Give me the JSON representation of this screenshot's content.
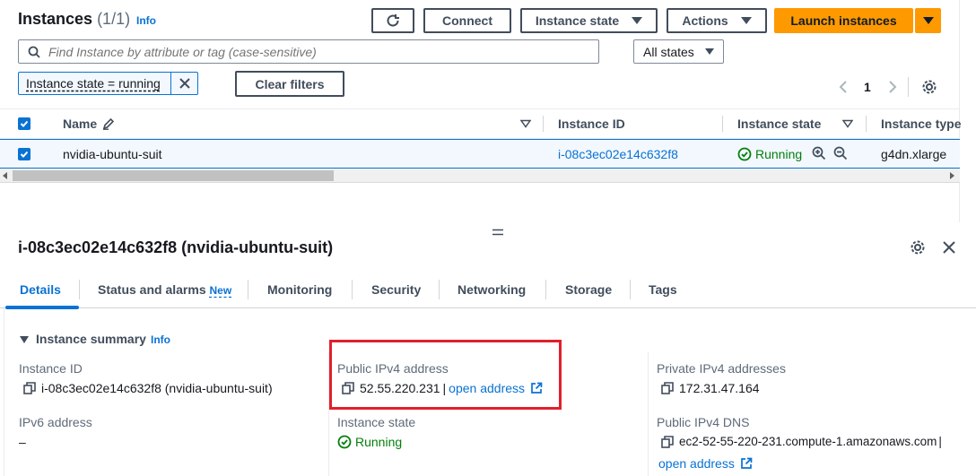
{
  "header": {
    "title": "Instances",
    "count": "(1/1)",
    "info": "Info",
    "connect": "Connect",
    "instance_state": "Instance state",
    "actions": "Actions",
    "launch": "Launch instances"
  },
  "filter": {
    "search_placeholder": "Find Instance by attribute or tag (case-sensitive)",
    "states_select": "All states",
    "token": "Instance state = running",
    "clear": "Clear filters",
    "page": "1"
  },
  "table": {
    "columns": [
      "Name",
      "Instance ID",
      "Instance state",
      "Instance type"
    ],
    "rows": [
      {
        "name": "nvidia-ubuntu-suit",
        "id": "i-08c3ec02e14c632f8",
        "state": "Running",
        "type": "g4dn.xlarge"
      }
    ]
  },
  "details": {
    "title": "i-08c3ec02e14c632f8 (nvidia-ubuntu-suit)",
    "tabs": [
      "Details",
      "Status and alarms",
      "Monitoring",
      "Security",
      "Networking",
      "Storage",
      "Tags"
    ],
    "new_badge": "New",
    "section": "Instance summary",
    "section_info": "Info",
    "instance_id_label": "Instance ID",
    "instance_id_value": "i-08c3ec02e14c632f8 (nvidia-ubuntu-suit)",
    "ipv6_label": "IPv6 address",
    "ipv6_value": "–",
    "public_ipv4_label": "Public IPv4 address",
    "public_ipv4_value": "52.55.220.231",
    "separator": "|",
    "open_address": "open address",
    "instance_state_label": "Instance state",
    "instance_state_value": "Running",
    "private_ipv4_label": "Private IPv4 addresses",
    "private_ipv4_value": "172.31.47.164",
    "public_dns_label": "Public IPv4 DNS",
    "public_dns_value": "ec2-52-55-220-231.compute-1.amazonaws.com",
    "dns_sep": "|",
    "dns_open_address": "open address"
  },
  "colors": {
    "primary": "#ff9900",
    "link": "#0972d3",
    "success": "#037f0c",
    "highlight": "#e0202c"
  }
}
